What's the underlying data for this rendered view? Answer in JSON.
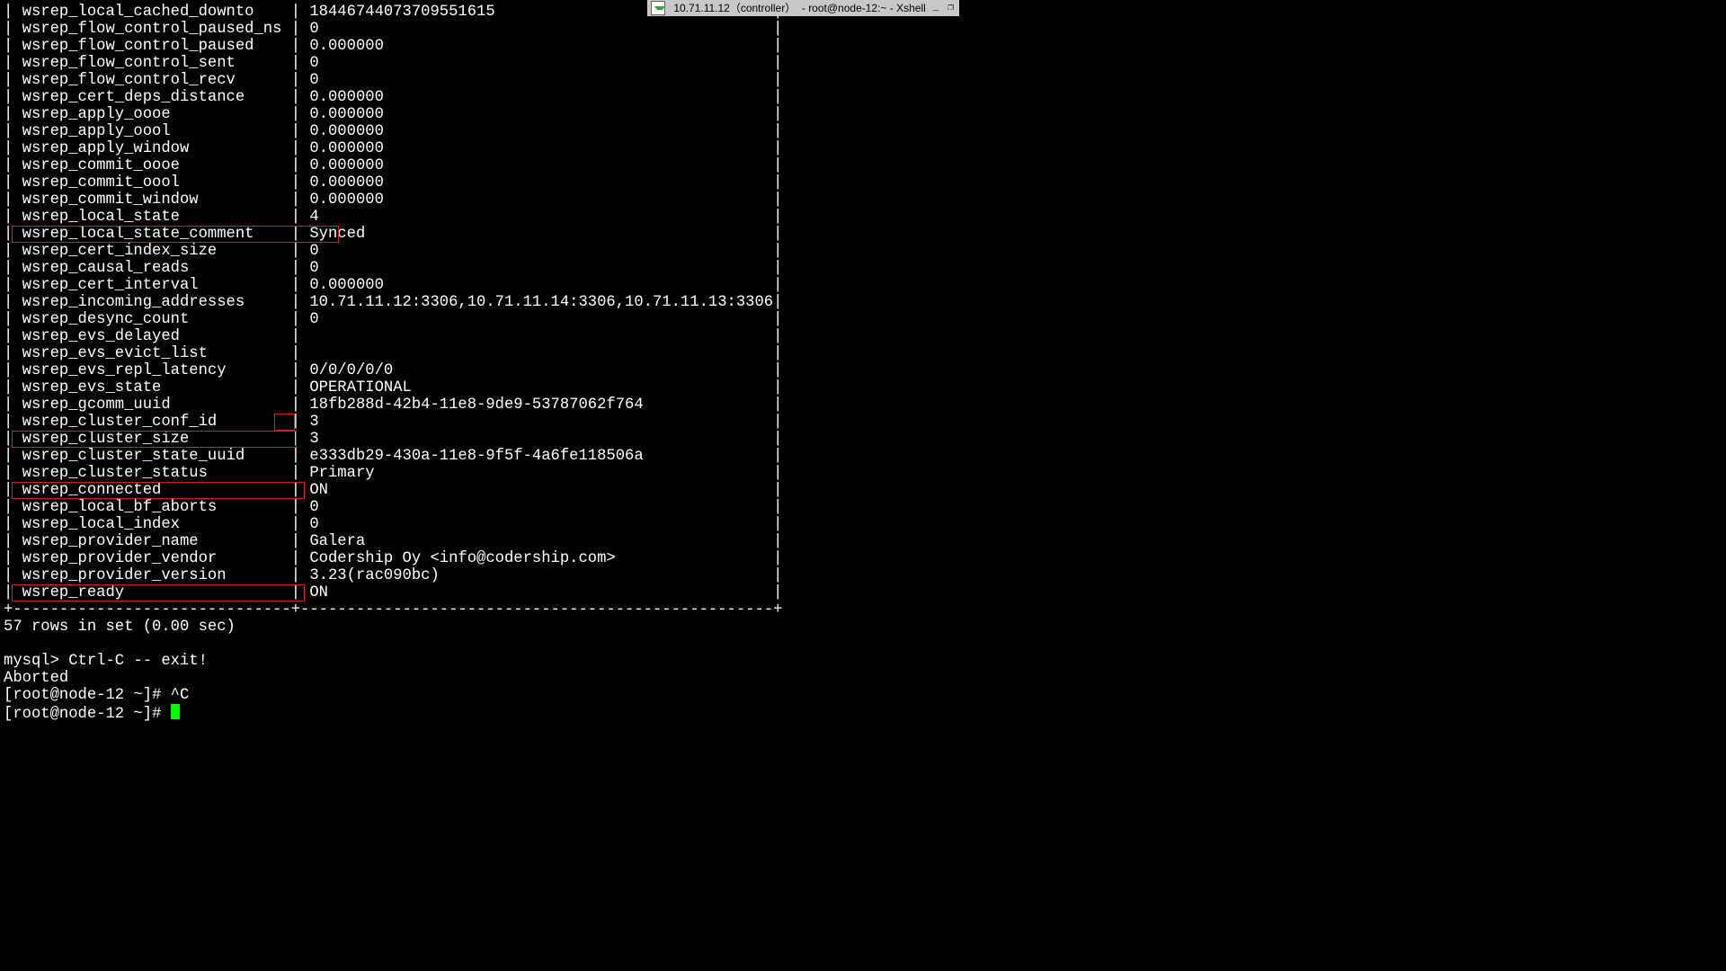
{
  "window": {
    "title": " 10.71.11.12（controller）  - root@node-12:~ - Xshell"
  },
  "rows": [
    {
      "name": "wsrep_local_cached_downto",
      "value": "18446744073709551615"
    },
    {
      "name": "wsrep_flow_control_paused_ns",
      "value": "0"
    },
    {
      "name": "wsrep_flow_control_paused",
      "value": "0.000000"
    },
    {
      "name": "wsrep_flow_control_sent",
      "value": "0"
    },
    {
      "name": "wsrep_flow_control_recv",
      "value": "0"
    },
    {
      "name": "wsrep_cert_deps_distance",
      "value": "0.000000"
    },
    {
      "name": "wsrep_apply_oooe",
      "value": "0.000000"
    },
    {
      "name": "wsrep_apply_oool",
      "value": "0.000000"
    },
    {
      "name": "wsrep_apply_window",
      "value": "0.000000"
    },
    {
      "name": "wsrep_commit_oooe",
      "value": "0.000000"
    },
    {
      "name": "wsrep_commit_oool",
      "value": "0.000000"
    },
    {
      "name": "wsrep_commit_window",
      "value": "0.000000"
    },
    {
      "name": "wsrep_local_state",
      "value": "4"
    },
    {
      "name": "wsrep_local_state_comment",
      "value": "Synced",
      "hl": "full"
    },
    {
      "name": "wsrep_cert_index_size",
      "value": "0"
    },
    {
      "name": "wsrep_causal_reads",
      "value": "0"
    },
    {
      "name": "wsrep_cert_interval",
      "value": "0.000000"
    },
    {
      "name": "wsrep_incoming_addresses",
      "value": "10.71.11.12:3306,10.71.11.14:3306,10.71.11.13:3306"
    },
    {
      "name": "wsrep_desync_count",
      "value": "0"
    },
    {
      "name": "wsrep_evs_delayed",
      "value": ""
    },
    {
      "name": "wsrep_evs_evict_list",
      "value": ""
    },
    {
      "name": "wsrep_evs_repl_latency",
      "value": "0/0/0/0/0"
    },
    {
      "name": "wsrep_evs_state",
      "value": "OPERATIONAL"
    },
    {
      "name": "wsrep_gcomm_uuid",
      "value": "18fb288d-42b4-11e8-9de9-53787062f764"
    },
    {
      "name": "wsrep_cluster_conf_id",
      "value": "3",
      "hl": "valonly"
    },
    {
      "name": "wsrep_cluster_size",
      "value": "3",
      "hl": "full"
    },
    {
      "name": "wsrep_cluster_state_uuid",
      "value": "e333db29-430a-11e8-9f5f-4a6fe118506a"
    },
    {
      "name": "wsrep_cluster_status",
      "value": "Primary"
    },
    {
      "name": "wsrep_connected",
      "value": "ON",
      "hl": "full"
    },
    {
      "name": "wsrep_local_bf_aborts",
      "value": "0"
    },
    {
      "name": "wsrep_local_index",
      "value": "0"
    },
    {
      "name": "wsrep_provider_name",
      "value": "Galera"
    },
    {
      "name": "wsrep_provider_vendor",
      "value": "Codership Oy <info@codership.com>"
    },
    {
      "name": "wsrep_provider_version",
      "value": "3.23(rac090bc)"
    },
    {
      "name": "wsrep_ready",
      "value": "ON",
      "hl": "full"
    }
  ],
  "footer": {
    "rows_msg": "57 rows in set (0.00 sec)",
    "mysql_exit": "mysql> Ctrl-C -- exit!",
    "aborted": "Aborted",
    "prompt1": "[root@node-12 ~]# ^C",
    "prompt2": "[root@node-12 ~]# "
  }
}
